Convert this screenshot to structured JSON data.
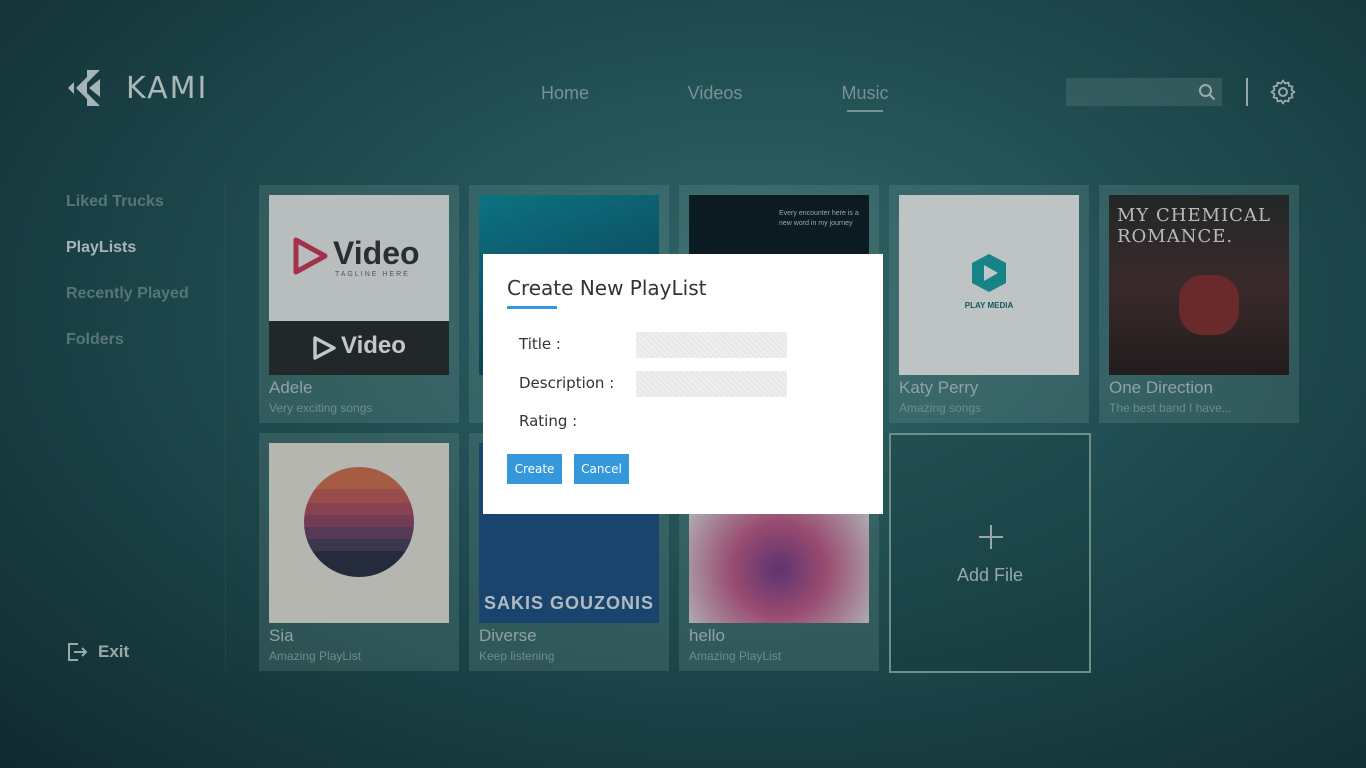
{
  "app": {
    "name": "KAMI"
  },
  "nav": {
    "tabs": [
      "Home",
      "Videos",
      "Music"
    ],
    "active": "Music"
  },
  "sidebar": {
    "items": [
      {
        "label": "Liked Trucks"
      },
      {
        "label": "PlayLists"
      },
      {
        "label": "Recently Played"
      },
      {
        "label": "Folders"
      }
    ],
    "active": "PlayLists",
    "exit_label": "Exit"
  },
  "playlists": [
    {
      "title": "Adele",
      "subtitle": "Very exciting songs",
      "art_text": "Video",
      "art_tag": "TAGLINE HERE"
    },
    {
      "title": "",
      "subtitle": ""
    },
    {
      "title": "",
      "subtitle": "",
      "art_text": "Every encounter here is a new word in my journey"
    },
    {
      "title": "Katy Perry",
      "subtitle": "Amazing songs",
      "art_text": "PLAY MEDIA"
    },
    {
      "title": "One Direction",
      "subtitle": "The best band I have...",
      "art_text": "MY CHEMICAL ROMANCE."
    },
    {
      "title": "Sia",
      "subtitle": "Amazing PlayList"
    },
    {
      "title": "Diverse",
      "subtitle": "Keep listening",
      "art_text": "SAKIS GOUZONIS"
    },
    {
      "title": "hello",
      "subtitle": "Amazing PlayList"
    }
  ],
  "add_file": {
    "label": "Add File"
  },
  "dialog": {
    "title": "Create New PlayList",
    "fields": {
      "title_label": "Title :",
      "description_label": "Description :",
      "rating_label": "Rating :"
    },
    "title_value": "",
    "description_value": "",
    "create_label": "Create",
    "cancel_label": "Cancel"
  },
  "colors": {
    "accent": "#3498db",
    "background": "#2b6266"
  }
}
